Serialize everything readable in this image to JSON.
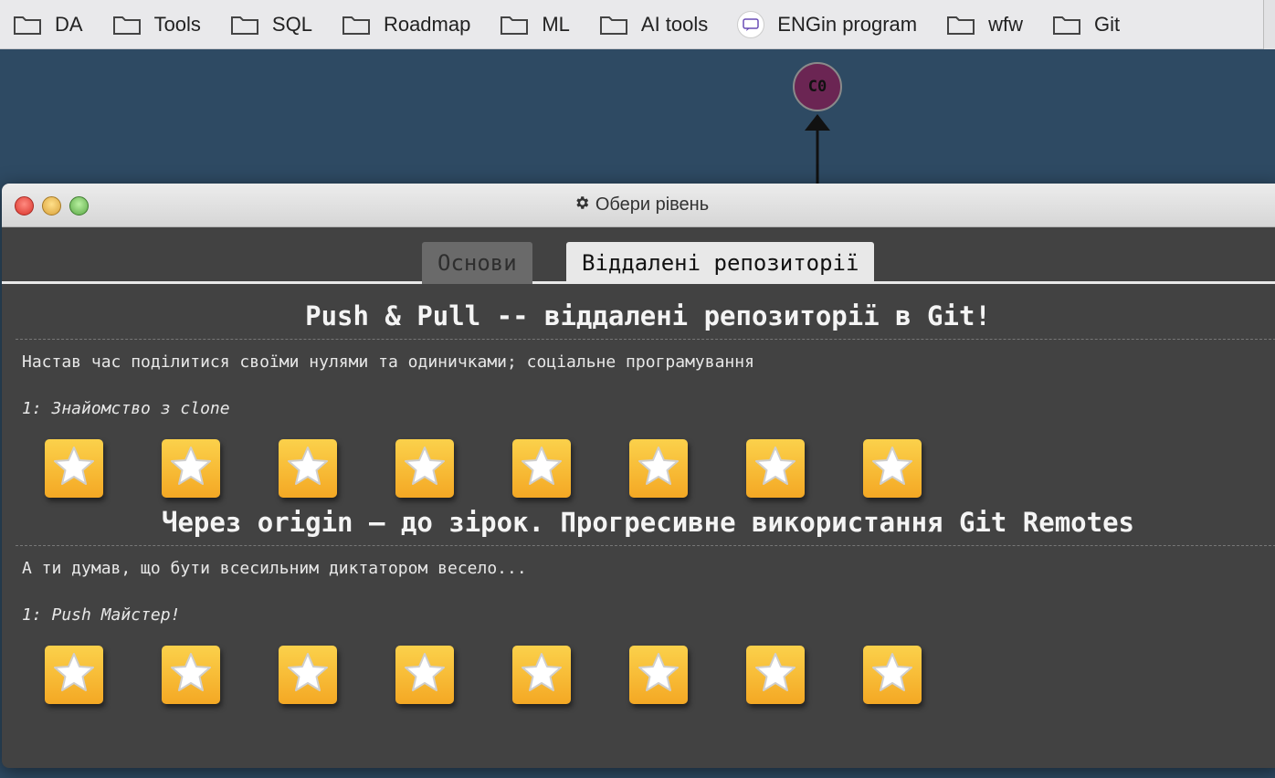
{
  "bookmarks": [
    {
      "label": "DA",
      "icon": "folder-icon"
    },
    {
      "label": "Tools",
      "icon": "folder-icon"
    },
    {
      "label": "SQL",
      "icon": "folder-icon"
    },
    {
      "label": "Roadmap",
      "icon": "folder-icon"
    },
    {
      "label": "ML",
      "icon": "folder-icon"
    },
    {
      "label": "AI tools",
      "icon": "folder-icon"
    },
    {
      "label": "ENGin program",
      "icon": "site-icon"
    },
    {
      "label": "wfw",
      "icon": "folder-icon"
    },
    {
      "label": "Git",
      "icon": "folder-icon"
    }
  ],
  "graph": {
    "node_label": "C0"
  },
  "window": {
    "title": "Обери рівень",
    "title_icon": "gear-icon"
  },
  "tabs": [
    {
      "label": "Основи",
      "active": false
    },
    {
      "label": "Віддалені репозиторії",
      "active": true
    }
  ],
  "sections": [
    {
      "title": "Push & Pull -- віддалені репозиторії в Git!",
      "description": "Настав час поділитися своїми нулями та одиничками; соціальне програмування",
      "level": "1: Знайомство з clone",
      "star_count": 8
    },
    {
      "title": "Через origin – до зірок. Прогресивне використання Git Remotes",
      "description": "А ти думав, що бути всесильним диктатором весело...",
      "level": "1: Push Майстер!",
      "star_count": 8
    }
  ],
  "colors": {
    "accent": "#f4a824",
    "background": "#2e4a63",
    "panel": "#424242"
  }
}
